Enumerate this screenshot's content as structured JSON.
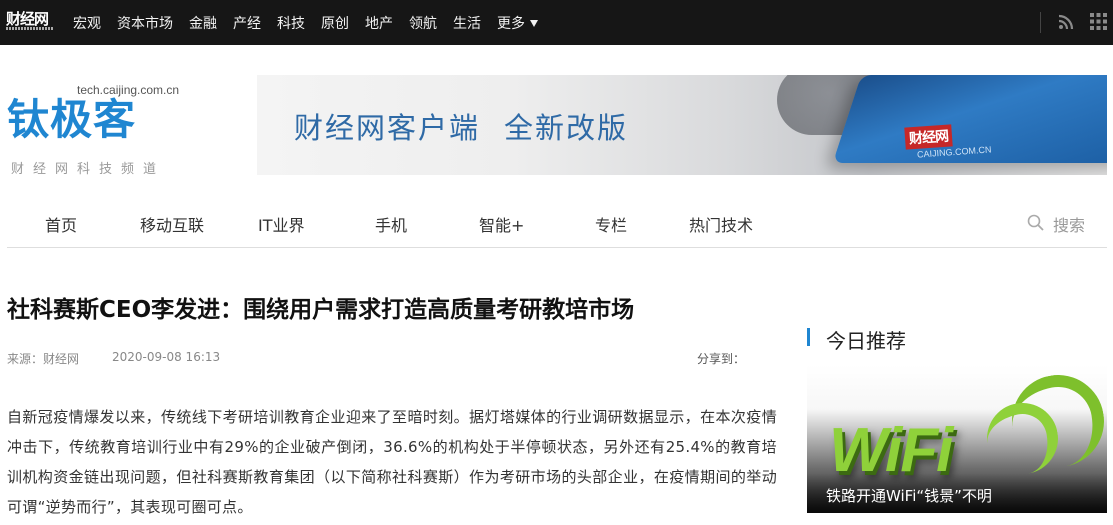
{
  "topbar": {
    "logo_text": "财经网",
    "nav": [
      "宏观",
      "资本市场",
      "金融",
      "产经",
      "科技",
      "原创",
      "地产",
      "领航",
      "生活"
    ],
    "more_label": "更多"
  },
  "brand": {
    "url": "tech.caijing.com.cn",
    "name": "钛极客",
    "tagline": "财经网科技频道"
  },
  "banner": {
    "text_part1": "财经网客户端",
    "text_part2": "全新改版",
    "app_logo": "财经网",
    "app_url": "CAIJING.COM.CN"
  },
  "channel_nav": {
    "items": [
      "首页",
      "移动互联",
      "IT业界",
      "手机",
      "智能+",
      "专栏",
      "热门技术"
    ],
    "search_label": "搜索"
  },
  "article": {
    "title": "社科赛斯CEO李发进：围绕用户需求打造高质量考研教培市场",
    "source": "来源：财经网",
    "time": "2020-09-08 16:13",
    "share_label": "分享到：",
    "body": "自新冠疫情爆发以来，传统线下考研培训教育企业迎来了至暗时刻。据灯塔媒体的行业调研数据显示，在本次疫情冲击下，传统教育培训行业中有29%的企业破产倒闭，36.6%的机构处于半停顿状态，另外还有25.4%的教育培训机构资金链出现问题，但社科赛斯教育集团（以下简称社科赛斯）作为考研市场的头部企业，在疫情期间的举动可谓“逆势而行”，其表现可圈可点。"
  },
  "sidebar": {
    "heading": "今日推荐",
    "card_image_text": "WiFi",
    "card_caption": "铁路开通WiFi“钱景”不明"
  },
  "colors": {
    "topbar_bg": "#161616",
    "brand_blue": "#1f86d1",
    "wifi_green": "#8fd13a"
  }
}
